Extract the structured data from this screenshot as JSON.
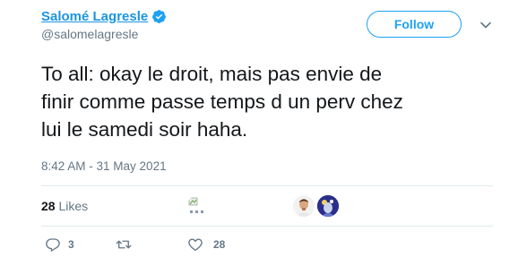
{
  "author": {
    "display_name": "Salomé Lagresle",
    "handle": "@salomelagresle",
    "verified_icon": "verified-badge-icon"
  },
  "follow_label": "Follow",
  "tweet": {
    "lines": [
      "To all: okay le droit, mais pas envie de",
      "finir comme passe temps d un perv chez",
      "lui le samedi soir haha."
    ],
    "timestamp": "8:42 AM - 31 May 2021"
  },
  "stats": {
    "likes_count": "28",
    "likes_label": "Likes"
  },
  "actions": {
    "reply_count": "3",
    "retweet_count": "",
    "like_count": "28"
  },
  "colors": {
    "accent": "#1da1f2",
    "name_link": "#1b95e0",
    "secondary_text": "#657786",
    "divider": "#e1e8ed"
  }
}
